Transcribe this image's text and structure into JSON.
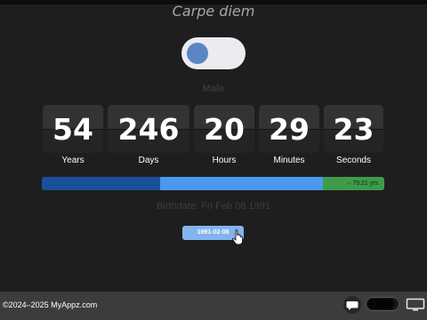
{
  "app": {
    "title": "Carpe diem"
  },
  "gender_toggle": {
    "label": "Male"
  },
  "age": [
    {
      "value": "54",
      "unit": "Years"
    },
    {
      "value": "246",
      "unit": "Days"
    },
    {
      "value": "20",
      "unit": "Hours"
    },
    {
      "value": "29",
      "unit": "Minutes"
    },
    {
      "value": "23",
      "unit": "Seconds"
    }
  ],
  "progress": {
    "segments": [
      {
        "color": "#19509a",
        "fraction": 0.345
      },
      {
        "color": "#4b98ec",
        "fraction": 0.475
      }
    ],
    "remainder_color": "#3f9b4a",
    "label": "←79.21 yrs."
  },
  "birthdate": {
    "text": "Birthdate: Fri Feb 08 1991"
  },
  "date_input": {
    "value": "1991-02-08"
  },
  "footer": {
    "copyright": "©2024–2025 MyAppz.com"
  },
  "icons": [
    "chat-icon",
    "dark-mode-toggle",
    "screen-icon",
    "hand-cursor-icon"
  ]
}
